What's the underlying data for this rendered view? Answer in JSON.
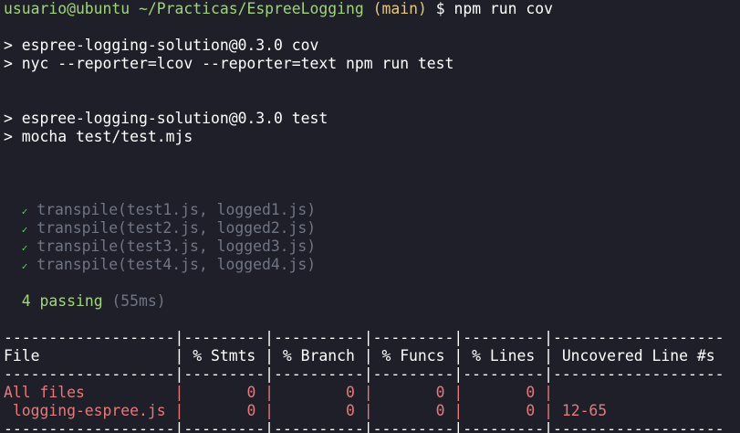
{
  "prompt": {
    "user_host": "usuario@ubuntu",
    "path": "~/Practicas/EspreeLogging",
    "branch": "(main)",
    "symbol": "$",
    "command": "npm run cov"
  },
  "npm_cov": {
    "line1": "> espree-logging-solution@0.3.0 cov",
    "line2": "> nyc --reporter=lcov --reporter=text npm run test"
  },
  "npm_test": {
    "line1": "> espree-logging-solution@0.3.0 test",
    "line2": "> mocha test/test.mjs"
  },
  "tests": {
    "check_symbol": "✓",
    "items": [
      "transpile(test1.js, logged1.js)",
      "transpile(test2.js, logged2.js)",
      "transpile(test3.js, logged3.js)",
      "transpile(test4.js, logged4.js)"
    ],
    "passing_label": "4 passing",
    "duration": "(55ms)"
  },
  "coverage": {
    "separator": "-------------------|---------|----------|---------|---------|-------------------",
    "header_row": "File               | % Stmts | % Branch | % Funcs | % Lines | Uncovered Line #s ",
    "rows": [
      {
        "file": "All files          ",
        "rest": "|       0 |        0 |       0 |       0 |                   ",
        "uncovered": ""
      },
      {
        "file": " logging-espree.js ",
        "rest": "|       0 |        0 |       0 |       0 | ",
        "uncovered": "12-65"
      }
    ]
  },
  "colors": {
    "background": "#1e1f29",
    "prompt_green": "#a0d47a",
    "branch_yellow": "#e9c77a",
    "dim_gray": "#707584",
    "coverage_red": "#e8797a",
    "check_green": "#55d855"
  }
}
